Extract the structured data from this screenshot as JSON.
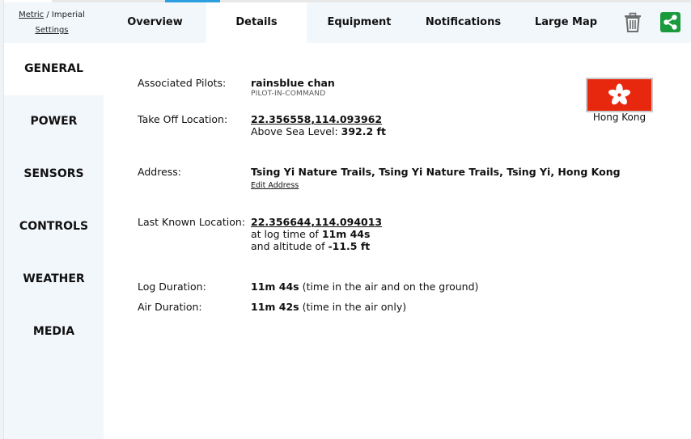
{
  "units": {
    "metric": "Metric",
    "separator": "/",
    "imperial": "Imperial",
    "settings": "Settings"
  },
  "tabs": [
    {
      "label": "Overview",
      "active": false
    },
    {
      "label": "Details",
      "active": true
    },
    {
      "label": "Equipment",
      "active": false
    },
    {
      "label": "Notifications",
      "active": false
    },
    {
      "label": "Large Map",
      "active": false
    }
  ],
  "toolbar": {
    "trash_icon": "trash-icon",
    "share_icon": "share-icon",
    "share_color": "#1a9a3c"
  },
  "sidebar": {
    "items": [
      {
        "label": "GENERAL",
        "active": true
      },
      {
        "label": "POWER",
        "active": false
      },
      {
        "label": "SENSORS",
        "active": false
      },
      {
        "label": "CONTROLS",
        "active": false
      },
      {
        "label": "WEATHER",
        "active": false
      },
      {
        "label": "MEDIA",
        "active": false
      }
    ]
  },
  "details": {
    "pilots_label": "Associated Pilots:",
    "pilot_name": "rainsblue chan",
    "pilot_role": "PILOT-IN-COMMAND",
    "takeoff_label": "Take Off Location:",
    "takeoff_coords": "22.356558,114.093962",
    "asl_label": "Above Sea Level:",
    "asl_value": "392.2 ft",
    "address_label": "Address:",
    "address_value": "Tsing Yi Nature Trails, Tsing Yi Nature Trails, Tsing Yi, Hong Kong",
    "edit_address": "Edit Address",
    "last_known_label": "Last Known Location:",
    "last_known_coords": "22.356644,114.094013",
    "log_time_prefix": "at log time of",
    "log_time_value": "11m 44s",
    "altitude_prefix": "and altitude of",
    "altitude_value": "-11.5 ft",
    "log_duration_label": "Log Duration:",
    "log_duration_value": "11m 44s",
    "log_duration_note": "(time in the air and on the ground)",
    "air_duration_label": "Air Duration:",
    "air_duration_value": "11m 42s",
    "air_duration_note": "(time in the air only)"
  },
  "flag": {
    "caption": "Hong Kong",
    "color": "#e8280e",
    "icon": "hong-kong-flag-icon"
  }
}
